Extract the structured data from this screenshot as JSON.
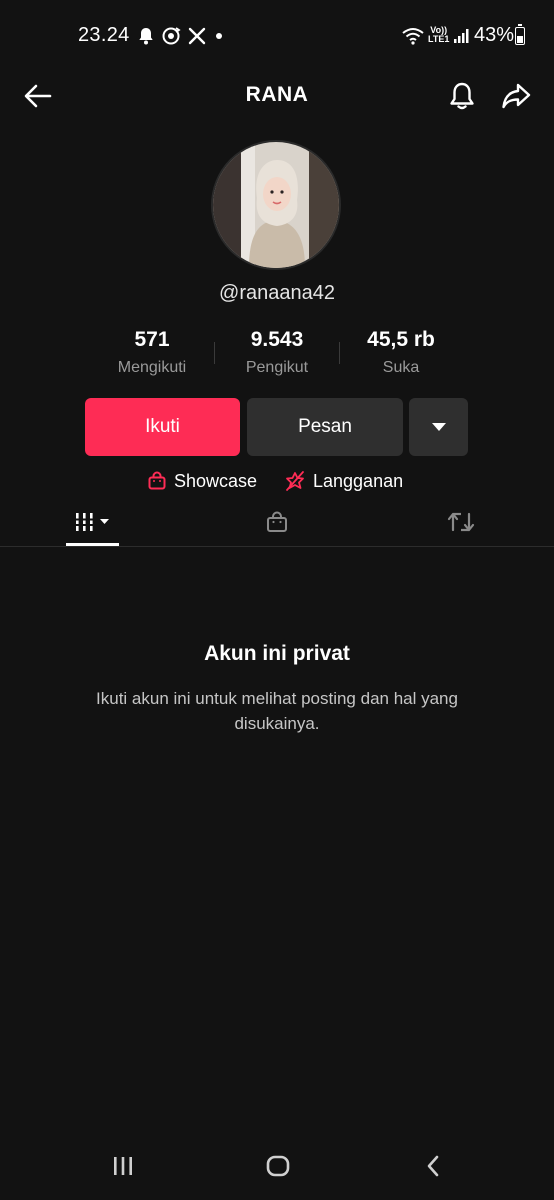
{
  "status_bar": {
    "time": "23.24",
    "volte_line1": "Vo))",
    "volte_line2": "LTE1",
    "battery": "43%",
    "battery_level": 0.43,
    "icons": [
      "bell-icon",
      "sync-icon",
      "x-logo-icon",
      "wifi-icon",
      "signal-icon",
      "battery-icon"
    ]
  },
  "header": {
    "title": "RANA",
    "icons": [
      "back-arrow-icon",
      "bell-icon",
      "share-icon"
    ]
  },
  "profile": {
    "username": "@ranaana42",
    "stats": [
      {
        "value": "571",
        "label": "Mengikuti"
      },
      {
        "value": "9.543",
        "label": "Pengikut"
      },
      {
        "value": "45,5 rb",
        "label": "Suka"
      }
    ]
  },
  "actions": {
    "follow": "Ikuti",
    "message": "Pesan",
    "more_icon": "triangle-down-icon"
  },
  "links": {
    "showcase": "Showcase",
    "subscription": "Langganan"
  },
  "tabs": {
    "icons": [
      "grid-icon",
      "shopping-bag-icon",
      "repost-icon"
    ]
  },
  "private": {
    "title": "Akun ini privat",
    "description": "Ikuti akun ini untuk melihat posting dan hal yang disukainya."
  },
  "nav_bar": {
    "icons": [
      "recents-icon",
      "home-icon",
      "back-icon"
    ]
  },
  "colors": {
    "background": "#121212",
    "accent": "#fe2c55",
    "button_secondary": "#2f2f2f",
    "muted_text": "#9a9a9a"
  }
}
